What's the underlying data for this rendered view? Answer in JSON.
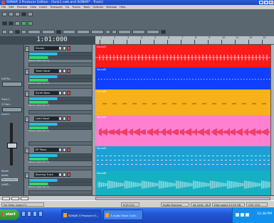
{
  "window": {
    "title": "SONAR 3 Producer Edition - [funk1.cwb and SONAR* - Track]",
    "buttons": [
      "_",
      "□",
      "×"
    ]
  },
  "menu": [
    "File",
    "Edit",
    "Process",
    "View",
    "Insert",
    "Transport",
    "Go",
    "Tracks",
    "Tools",
    "Options",
    "Window",
    "Help"
  ],
  "transport": {
    "time": "1:01:000"
  },
  "ruler": {
    "marks": [
      "1",
      "2",
      "3",
      "4",
      "5",
      "6",
      "7",
      "8",
      "9",
      "10",
      "11",
      "12",
      "13"
    ]
  },
  "inspector": {
    "labels": [
      "Left Ro...",
      "Track 1",
      "3 Chan..",
      "Level 1",
      "Sends",
      "Audio",
      "BackupTrack",
      "Left/R..."
    ]
  },
  "tracks": [
    {
      "number": "1",
      "name": "Drums",
      "io": "Stereo Input (Lin 1)",
      "clip": "Sound1",
      "color": "#ff1a1a",
      "wave": "spiky"
    },
    {
      "number": "2",
      "name": "Tamb Vocal",
      "io": "Stereo Input (Lin 1)",
      "clip": "Sound2",
      "color": "#1040ff",
      "wave": "dotted"
    },
    {
      "number": "3",
      "name": "Synth Bass",
      "io": "Stereo Input (Lin 1)",
      "clip": "Sound3",
      "color": "#f7b11a",
      "wave": "sparse"
    },
    {
      "number": "4",
      "name": "Lead Vocal",
      "io": "Stereo Input (Lin 1)",
      "clip": "Sound4",
      "color": "#ff7fd0",
      "wave": "burst"
    },
    {
      "number": "5",
      "name": "EP Piano",
      "io": "Stereo Input (Lin 1)",
      "clip": "Sound5",
      "color": "#1aa1d6",
      "wave": "dashed"
    },
    {
      "number": "6",
      "name": "Backing Track",
      "io": "Stereo Input (Lin 1)",
      "clip": "Sound6",
      "color": "#15b1c2",
      "wave": "dense"
    }
  ],
  "status": {
    "left": "For Help, press F1",
    "time": "9:01:021",
    "mode": "Audio Running",
    "format": "44.1kHz, 16-bit",
    "disk": "Disk space 12.50 GB",
    "cpu": "CPU 12%"
  },
  "taskbar": {
    "start_label": "start",
    "tasks": [
      "SONAR 3 Producer E...",
      "3 Audio Track Conf..."
    ],
    "clock": "12:38 PM"
  }
}
